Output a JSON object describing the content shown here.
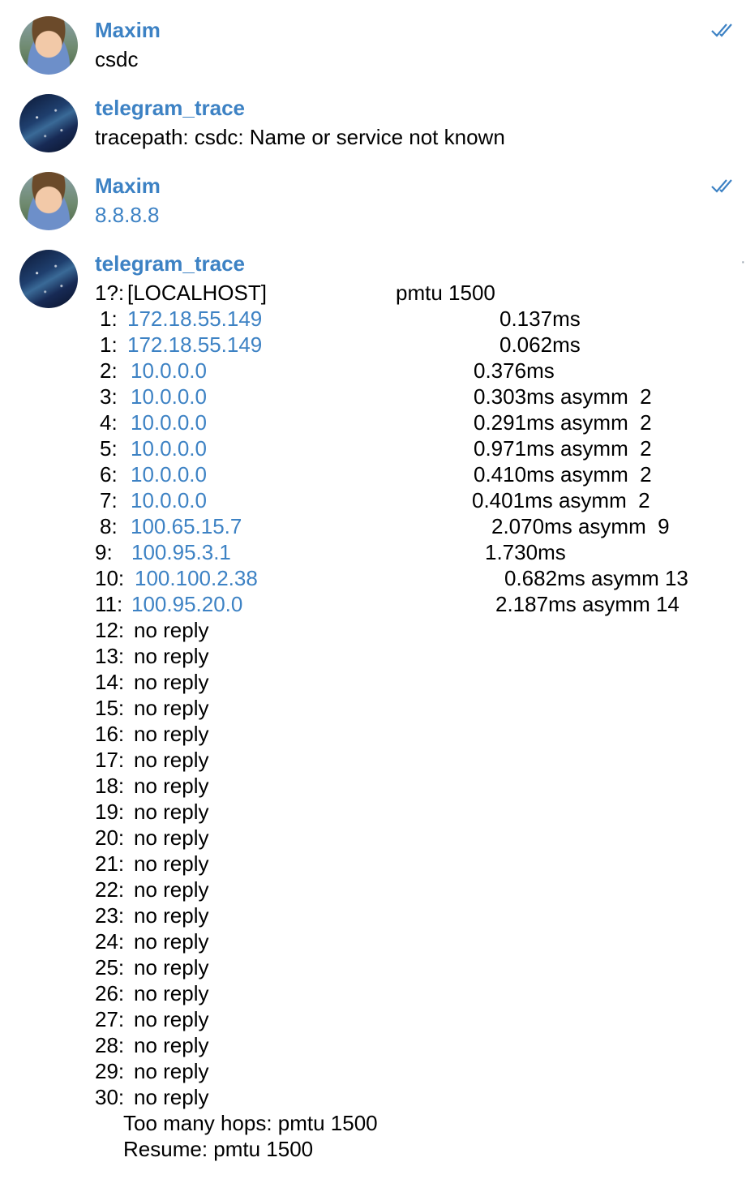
{
  "messages": [
    {
      "sender": "Maxim",
      "text": "csdc",
      "read": true
    },
    {
      "sender": "telegram_trace",
      "text": "tracepath: csdc: Name or service not known"
    },
    {
      "sender": "Maxim",
      "text": "8.8.8.8",
      "read": true
    },
    {
      "sender": "telegram_trace"
    }
  ],
  "trace": {
    "header": {
      "hop": "1?:",
      "host": "[LOCALHOST]",
      "result": "pmtu 1500"
    },
    "hops": [
      {
        "hop": "1:",
        "host": "172.18.55.149",
        "result": "0.137ms"
      },
      {
        "hop": "1:",
        "host": "172.18.55.149",
        "result": "0.062ms"
      },
      {
        "hop": "2:",
        "host": "10.0.0.0",
        "result": "0.376ms"
      },
      {
        "hop": "3:",
        "host": "10.0.0.0",
        "result": "0.303ms asymm  2"
      },
      {
        "hop": "4:",
        "host": "10.0.0.0",
        "result": "0.291ms asymm  2"
      },
      {
        "hop": "5:",
        "host": "10.0.0.0",
        "result": "0.971ms asymm  2"
      },
      {
        "hop": "6:",
        "host": "10.0.0.0",
        "result": "0.410ms asymm  2"
      },
      {
        "hop": "7:",
        "host": "10.0.0.0",
        "result": "0.401ms asymm  2"
      },
      {
        "hop": "8:",
        "host": "100.65.15.7",
        "result": "2.070ms asymm  9"
      },
      {
        "hop": "9:",
        "host": "100.95.3.1",
        "result": "1.730ms"
      },
      {
        "hop": "10:",
        "host": "100.100.2.38",
        "result": "0.682ms asymm 13"
      },
      {
        "hop": "11:",
        "host": "100.95.20.0",
        "result": "2.187ms asymm 14"
      },
      {
        "hop": "12:",
        "host": "no reply"
      },
      {
        "hop": "13:",
        "host": "no reply"
      },
      {
        "hop": "14:",
        "host": "no reply"
      },
      {
        "hop": "15:",
        "host": "no reply"
      },
      {
        "hop": "16:",
        "host": "no reply"
      },
      {
        "hop": "17:",
        "host": "no reply"
      },
      {
        "hop": "18:",
        "host": "no reply"
      },
      {
        "hop": "19:",
        "host": "no reply"
      },
      {
        "hop": "20:",
        "host": "no reply"
      },
      {
        "hop": "21:",
        "host": "no reply"
      },
      {
        "hop": "22:",
        "host": "no reply"
      },
      {
        "hop": "23:",
        "host": "no reply"
      },
      {
        "hop": "24:",
        "host": "no reply"
      },
      {
        "hop": "25:",
        "host": "no reply"
      },
      {
        "hop": "26:",
        "host": "no reply"
      },
      {
        "hop": "27:",
        "host": "no reply"
      },
      {
        "hop": "28:",
        "host": "no reply"
      },
      {
        "hop": "29:",
        "host": "no reply"
      },
      {
        "hop": "30:",
        "host": "no reply"
      }
    ],
    "footer": [
      "Too many hops: pmtu 1500",
      "Resume: pmtu 1500"
    ]
  },
  "icons": {
    "read_receipt": "double-check-icon",
    "avatar_maxim": "avatar",
    "avatar_bot": "avatar"
  },
  "colors": {
    "accent": "#3d82c4",
    "text": "#000000",
    "background": "#ffffff"
  }
}
